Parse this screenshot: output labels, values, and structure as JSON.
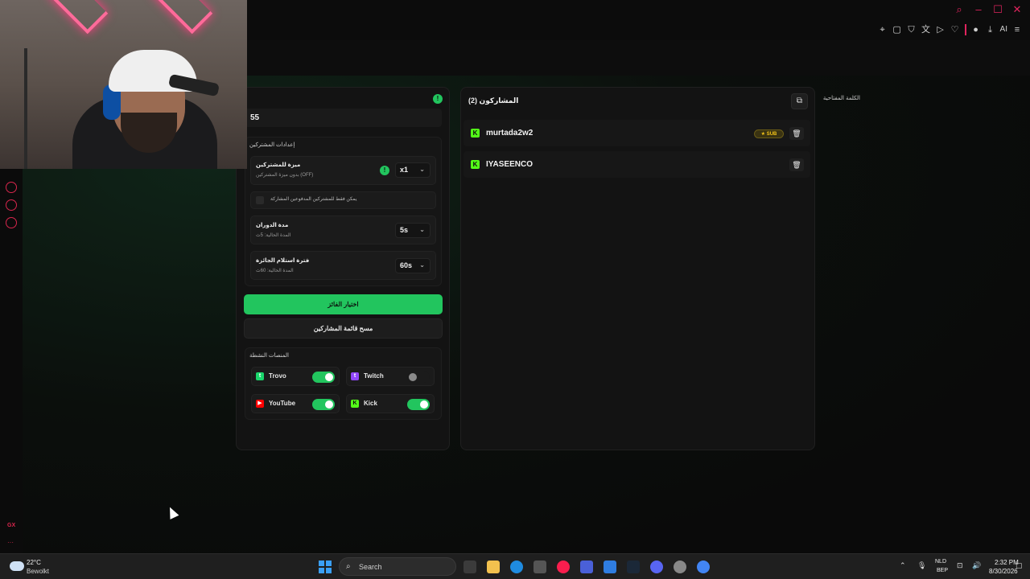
{
  "colors": {
    "accent": "#22c55e",
    "brand": "#d9264d",
    "kick": "#53fc18",
    "sub_badge": "#f5c518"
  },
  "window": {
    "controls": [
      "search-icon",
      "minimize-icon",
      "maximize-icon",
      "close-icon"
    ]
  },
  "toolbar": {
    "ai_label": "AI"
  },
  "keyword": {
    "label": "الكلمة المفتاحية",
    "value": "55"
  },
  "settings": {
    "title": "إعدادات المشتركين",
    "subscriber_perk": {
      "title": "ميزة للمشتركين",
      "subtitle": "بدون ميزة المشتركين (OFF)",
      "value": "x1"
    },
    "subs_only": {
      "label": "يمكن فقط للمشتركين المدفوعين المشاركة",
      "checked": false
    },
    "spin_duration": {
      "title": "مدة الدوران",
      "subtitle": "المدة الحالية: 5ث",
      "value": "5s"
    },
    "claim_period": {
      "title": "فترة استلام الجائزة",
      "subtitle": "المدة الحالية: 60ث",
      "value": "60s"
    }
  },
  "actions": {
    "pick_winner": "اختيار الفائز",
    "clear_list": "مسح قائمة المشاركين"
  },
  "platforms": {
    "title": "المنصات النشطة",
    "items": [
      {
        "name": "Trovo",
        "enabled": true,
        "color": "#19d66b"
      },
      {
        "name": "Twitch",
        "enabled": false,
        "color": "#9146ff"
      },
      {
        "name": "YouTube",
        "enabled": true,
        "color": "#ff0000"
      },
      {
        "name": "Kick",
        "enabled": true,
        "color": "#53fc18"
      }
    ]
  },
  "participants": {
    "title": "المشاركون (2)",
    "items": [
      {
        "name": "murtada2w2",
        "badge": "SUB",
        "platform": "Kick"
      },
      {
        "name": "IYASEENCO",
        "badge": "",
        "platform": "Kick"
      }
    ]
  },
  "sidebar": {
    "bottom_label": "GX"
  },
  "taskbar": {
    "weather_temp": "22°C",
    "weather_cond": "Bewolkt",
    "search_label": "Search",
    "lang_line1": "NLD",
    "lang_line2": "BEP",
    "time": "2:32 PM",
    "date": "8/30/2026"
  }
}
